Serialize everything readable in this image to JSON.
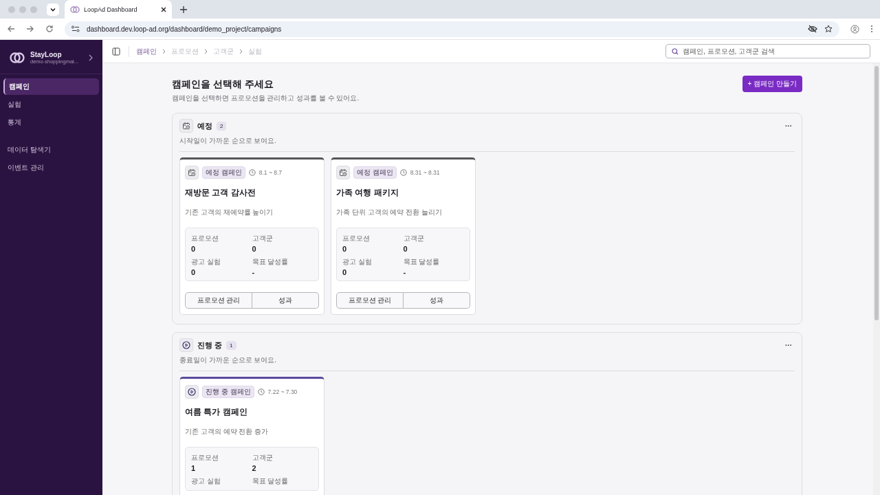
{
  "browser": {
    "tab_title": "LoopAd Dashboard",
    "url": "dashboard.dev.loop-ad.org/dashboard/demo_project/campaigns"
  },
  "sidebar": {
    "brand": "StayLoop",
    "project": "demo-shoppingmal...",
    "groups": [
      {
        "items": [
          {
            "label": "캠페인",
            "selected": true
          },
          {
            "label": "실험",
            "selected": false
          },
          {
            "label": "통계",
            "selected": false
          }
        ]
      },
      {
        "items": [
          {
            "label": "데이터 탐색기",
            "selected": false
          },
          {
            "label": "이벤트 관리",
            "selected": false
          }
        ]
      }
    ]
  },
  "breadcrumbs": [
    {
      "label": "캠페인",
      "selected": true
    },
    {
      "label": "프로모션",
      "selected": false
    },
    {
      "label": "고객군",
      "selected": false
    },
    {
      "label": "실험",
      "selected": false
    }
  ],
  "search": {
    "placeholder": "캠페인, 프로모션, 고객군 검색"
  },
  "page": {
    "title": "캠페인을 선택해 주세요",
    "subtitle": "캠페인을 선택하면 프로모션을 관리하고 성과를 볼 수 있어요.",
    "create_button": "+ 캠페인 만들기"
  },
  "sections": [
    {
      "kind": "scheduled",
      "title": "예정",
      "count": "2",
      "hint": "시작일이 가까운 순으로 보여요.",
      "more": "···",
      "campaigns": [
        {
          "badge": "예정 캠페인",
          "dates": "8.1 ~ 8.7",
          "name": "재방문 고객 감사전",
          "description": "기존 고객의 재예약률 높이기",
          "stats": [
            {
              "label": "프로모션",
              "value": "0"
            },
            {
              "label": "고객군",
              "value": "0"
            },
            {
              "label": "광고 실험",
              "value": "0"
            },
            {
              "label": "목표 달성률",
              "value": "-"
            }
          ],
          "buttons": [
            "프로모션 관리",
            "성과"
          ]
        },
        {
          "badge": "예정 캠페인",
          "dates": "8.31 ~ 8.31",
          "name": "가족 여행 패키지",
          "description": "가족 단위 고객의 예약 전환 늘리기",
          "stats": [
            {
              "label": "프로모션",
              "value": "0"
            },
            {
              "label": "고객군",
              "value": "0"
            },
            {
              "label": "광고 실험",
              "value": "0"
            },
            {
              "label": "목표 달성률",
              "value": "-"
            }
          ],
          "buttons": [
            "프로모션 관리",
            "성과"
          ]
        }
      ]
    },
    {
      "kind": "active",
      "title": "진행 중",
      "count": "1",
      "hint": "종료일이 가까운 순으로 보여요.",
      "more": "···",
      "campaigns": [
        {
          "badge": "진행 중 캠페인",
          "dates": "7.22 ~ 7.30",
          "name": "여름 특가 캠페인",
          "description": "기존 고객의 예약 전환 증가",
          "stats": [
            {
              "label": "프로모션",
              "value": "1"
            },
            {
              "label": "고객군",
              "value": "2"
            },
            {
              "label": "광고 실험"
            },
            {
              "label": "목표 달성률"
            }
          ]
        }
      ]
    }
  ]
}
